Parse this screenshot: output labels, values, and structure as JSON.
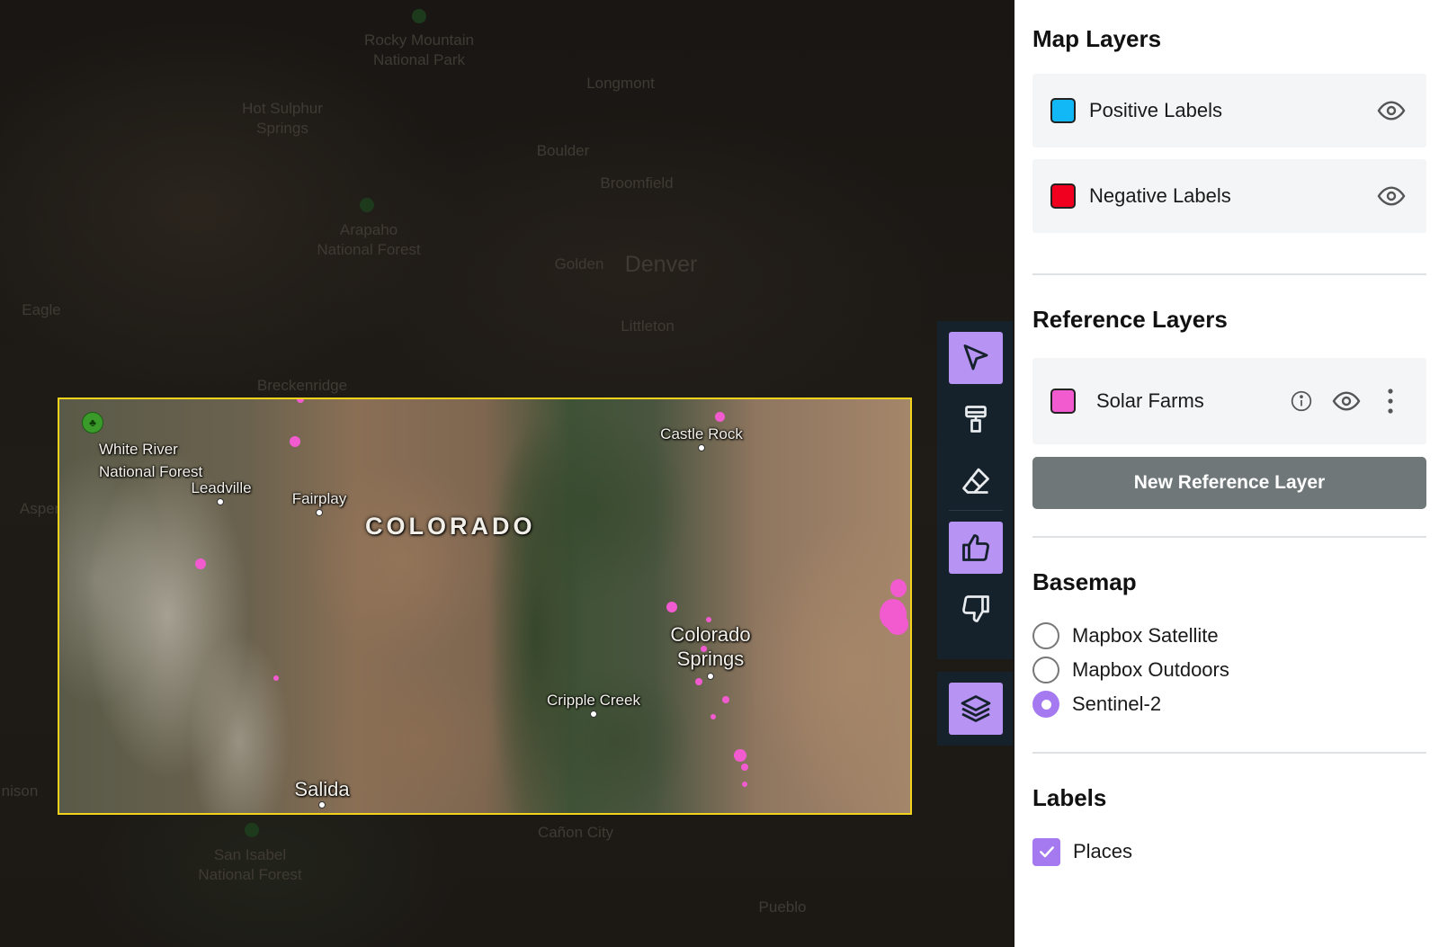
{
  "map": {
    "background_labels": {
      "rocky_mountain": "Rocky Mountain\nNational Park",
      "longmont": "Longmont",
      "hot_sulphur": "Hot Sulphur\nSprings",
      "boulder": "Boulder",
      "broomfield": "Broomfield",
      "arapaho": "Arapaho\nNational Forest",
      "golden": "Golden",
      "denver": "Denver",
      "eagle": "Eagle",
      "littleton": "Littleton",
      "breckenridge": "Breckenridge",
      "aspen": "Aspen",
      "gunnison": "nison",
      "canon_city": "Cañon City",
      "san_isabel": "San Isabel\nNational Forest",
      "pueblo": "Pueblo"
    },
    "aoi_labels": {
      "white_river": "White River\nNational Forest",
      "castle_rock": "Castle Rock",
      "leadville": "Leadville",
      "fairplay": "Fairplay",
      "state": "COLORADO",
      "colorado_springs": "Colorado\nSprings",
      "cripple_creek": "Cripple Creek",
      "salida": "Salida"
    },
    "aoi_border_color": "#f3d21b",
    "marker_color": "#f25bd0"
  },
  "toolbar": {
    "tools": [
      {
        "name": "select-tool",
        "icon": "cursor-arrow-icon",
        "active": true
      },
      {
        "name": "paint-tool",
        "icon": "paint-roller-icon",
        "active": false
      },
      {
        "name": "eraser-tool",
        "icon": "eraser-icon",
        "active": false
      },
      {
        "name": "positive-label-tool",
        "icon": "thumbs-up-icon",
        "active": true
      },
      {
        "name": "negative-label-tool",
        "icon": "thumbs-down-icon",
        "active": false
      }
    ],
    "layers_toggle": {
      "icon": "layers-icon",
      "active": true
    },
    "accent": "#b794f4",
    "bg": "#15222c"
  },
  "sidebar": {
    "map_layers": {
      "title": "Map Layers",
      "items": [
        {
          "label": "Positive Labels",
          "color": "#12b8f6",
          "icon": "eye-icon"
        },
        {
          "label": "Negative Labels",
          "color": "#f0001e",
          "icon": "eye-icon"
        }
      ]
    },
    "reference_layers": {
      "title": "Reference Layers",
      "items": [
        {
          "label": "Solar Farms",
          "color": "#f25bd0",
          "icons": [
            "info-icon",
            "eye-icon",
            "kebab-menu-icon"
          ]
        }
      ],
      "new_button": "New Reference Layer"
    },
    "basemap": {
      "title": "Basemap",
      "options": [
        "Mapbox Satellite",
        "Mapbox Outdoors",
        "Sentinel-2"
      ],
      "selected": "Sentinel-2"
    },
    "labels": {
      "title": "Labels",
      "options": [
        {
          "label": "Places",
          "checked": true
        }
      ]
    }
  }
}
